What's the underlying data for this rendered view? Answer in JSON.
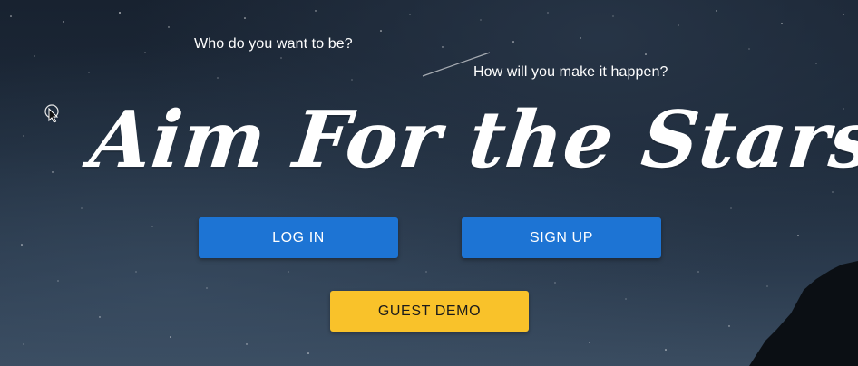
{
  "hero": {
    "tagline_1": "Who do you want to be?",
    "tagline_2": "How will you make it happen?",
    "title": "Aim For the Stars."
  },
  "actions": {
    "login_label": "LOG IN",
    "signup_label": "SIGN UP",
    "guest_label": "GUEST DEMO"
  },
  "colors": {
    "primary": "#1d74d4",
    "guest": "#f9c22a",
    "sky": "#1f2a37"
  },
  "icons": {
    "cursor": "mouse-cursor-icon",
    "background": "night-sky-stars"
  }
}
